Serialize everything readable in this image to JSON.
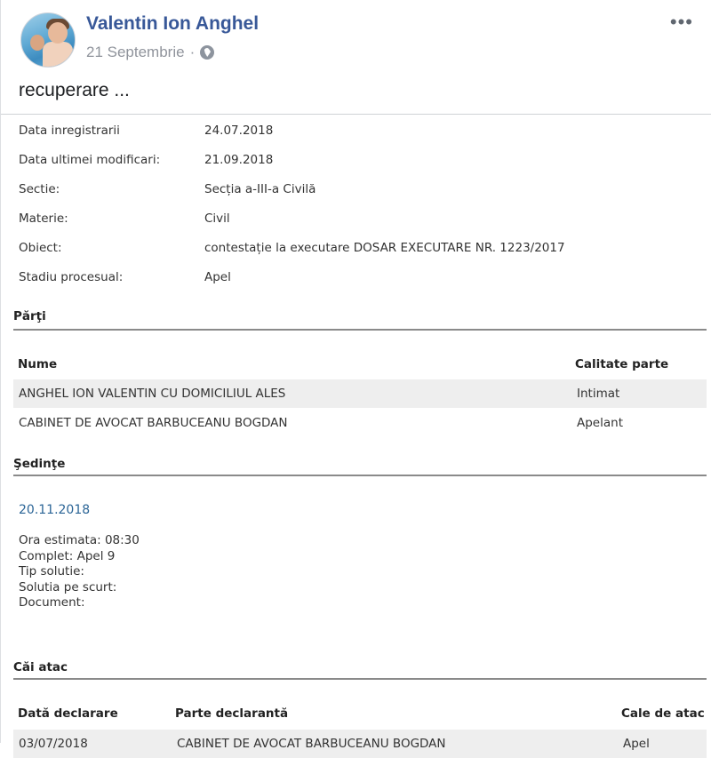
{
  "post": {
    "author": "Valentin Ion Anghel",
    "date": "21 Septembrie",
    "dot": "·",
    "privacy_icon": "globe-icon",
    "more_icon": "•••",
    "text": "recuperare ..."
  },
  "details": [
    {
      "label": "Data inregistrarii",
      "value": "24.07.2018"
    },
    {
      "label": "Data ultimei modificari:",
      "value": "21.09.2018"
    },
    {
      "label": "Sectie:",
      "value": "Secția a-III-a Civilă"
    },
    {
      "label": "Materie:",
      "value": "Civil"
    },
    {
      "label": "Obiect:",
      "value": "contestație la executare DOSAR EXECUTARE NR. 1223/2017"
    },
    {
      "label": "Stadiu procesual:",
      "value": "Apel"
    }
  ],
  "parti": {
    "title": "Părţi",
    "col_name": "Nume",
    "col_role": "Calitate parte",
    "rows": [
      {
        "name": "ANGHEL ION VALENTIN CU DOMICILIUL ALES",
        "role": "Intimat"
      },
      {
        "name": "CABINET DE AVOCAT BARBUCEANU BOGDAN",
        "role": "Apelant"
      }
    ]
  },
  "sedinte": {
    "title": "Şedinţe",
    "date": "20.11.2018",
    "lines": [
      "Ora estimata: 08:30",
      "Complet: Apel 9",
      "Tip solutie:",
      "Solutia pe scurt:",
      "Document:"
    ]
  },
  "cai_atac": {
    "title": "Căi atac",
    "col_date": "Dată declarare",
    "col_party": "Parte declarantă",
    "col_type": "Cale de atac",
    "rows": [
      {
        "date": "03/07/2018",
        "party": "CABINET DE AVOCAT BARBUCEANU BOGDAN",
        "type": "Apel"
      }
    ]
  }
}
